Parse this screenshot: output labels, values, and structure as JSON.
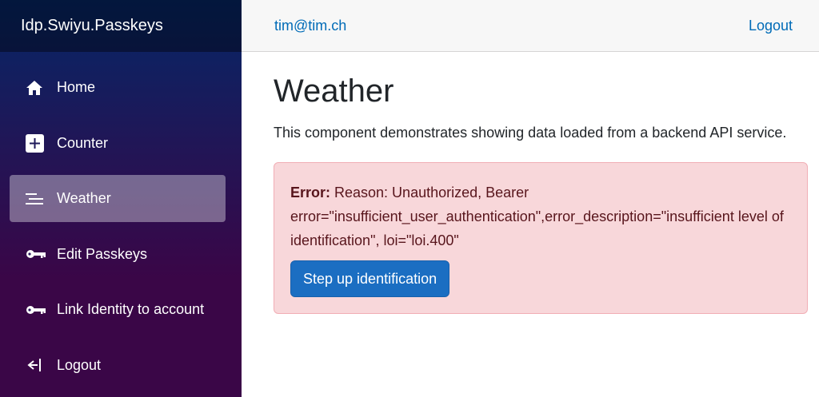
{
  "brand": "Idp.Swiyu.Passkeys",
  "topbar": {
    "user": "tim@tim.ch",
    "logout": "Logout"
  },
  "nav": [
    {
      "label": "Home",
      "icon": "house-icon"
    },
    {
      "label": "Counter",
      "icon": "plus-square-icon"
    },
    {
      "label": "Weather",
      "icon": "list-icon",
      "active": true
    },
    {
      "label": "Edit Passkeys",
      "icon": "key-icon"
    },
    {
      "label": "Link Identity to account",
      "icon": "key-icon"
    },
    {
      "label": "Logout",
      "icon": "logout-arrow-icon"
    }
  ],
  "page": {
    "title": "Weather",
    "intro": "This component demonstrates showing data loaded from a backend API service."
  },
  "alert": {
    "label": "Error:",
    "message": " Reason: Unauthorized, Bearer error=\"insufficient_user_authentication\",error_description=\"insufficient level of identification\", loi=\"loi.400\"",
    "button": "Step up identification"
  },
  "colors": {
    "sidebar_top": "#052767",
    "sidebar_bottom": "#3a0647",
    "link": "#006bb7",
    "alert_bg": "#f8d7da",
    "alert_text": "#58151c",
    "button": "#1b6ec2"
  }
}
